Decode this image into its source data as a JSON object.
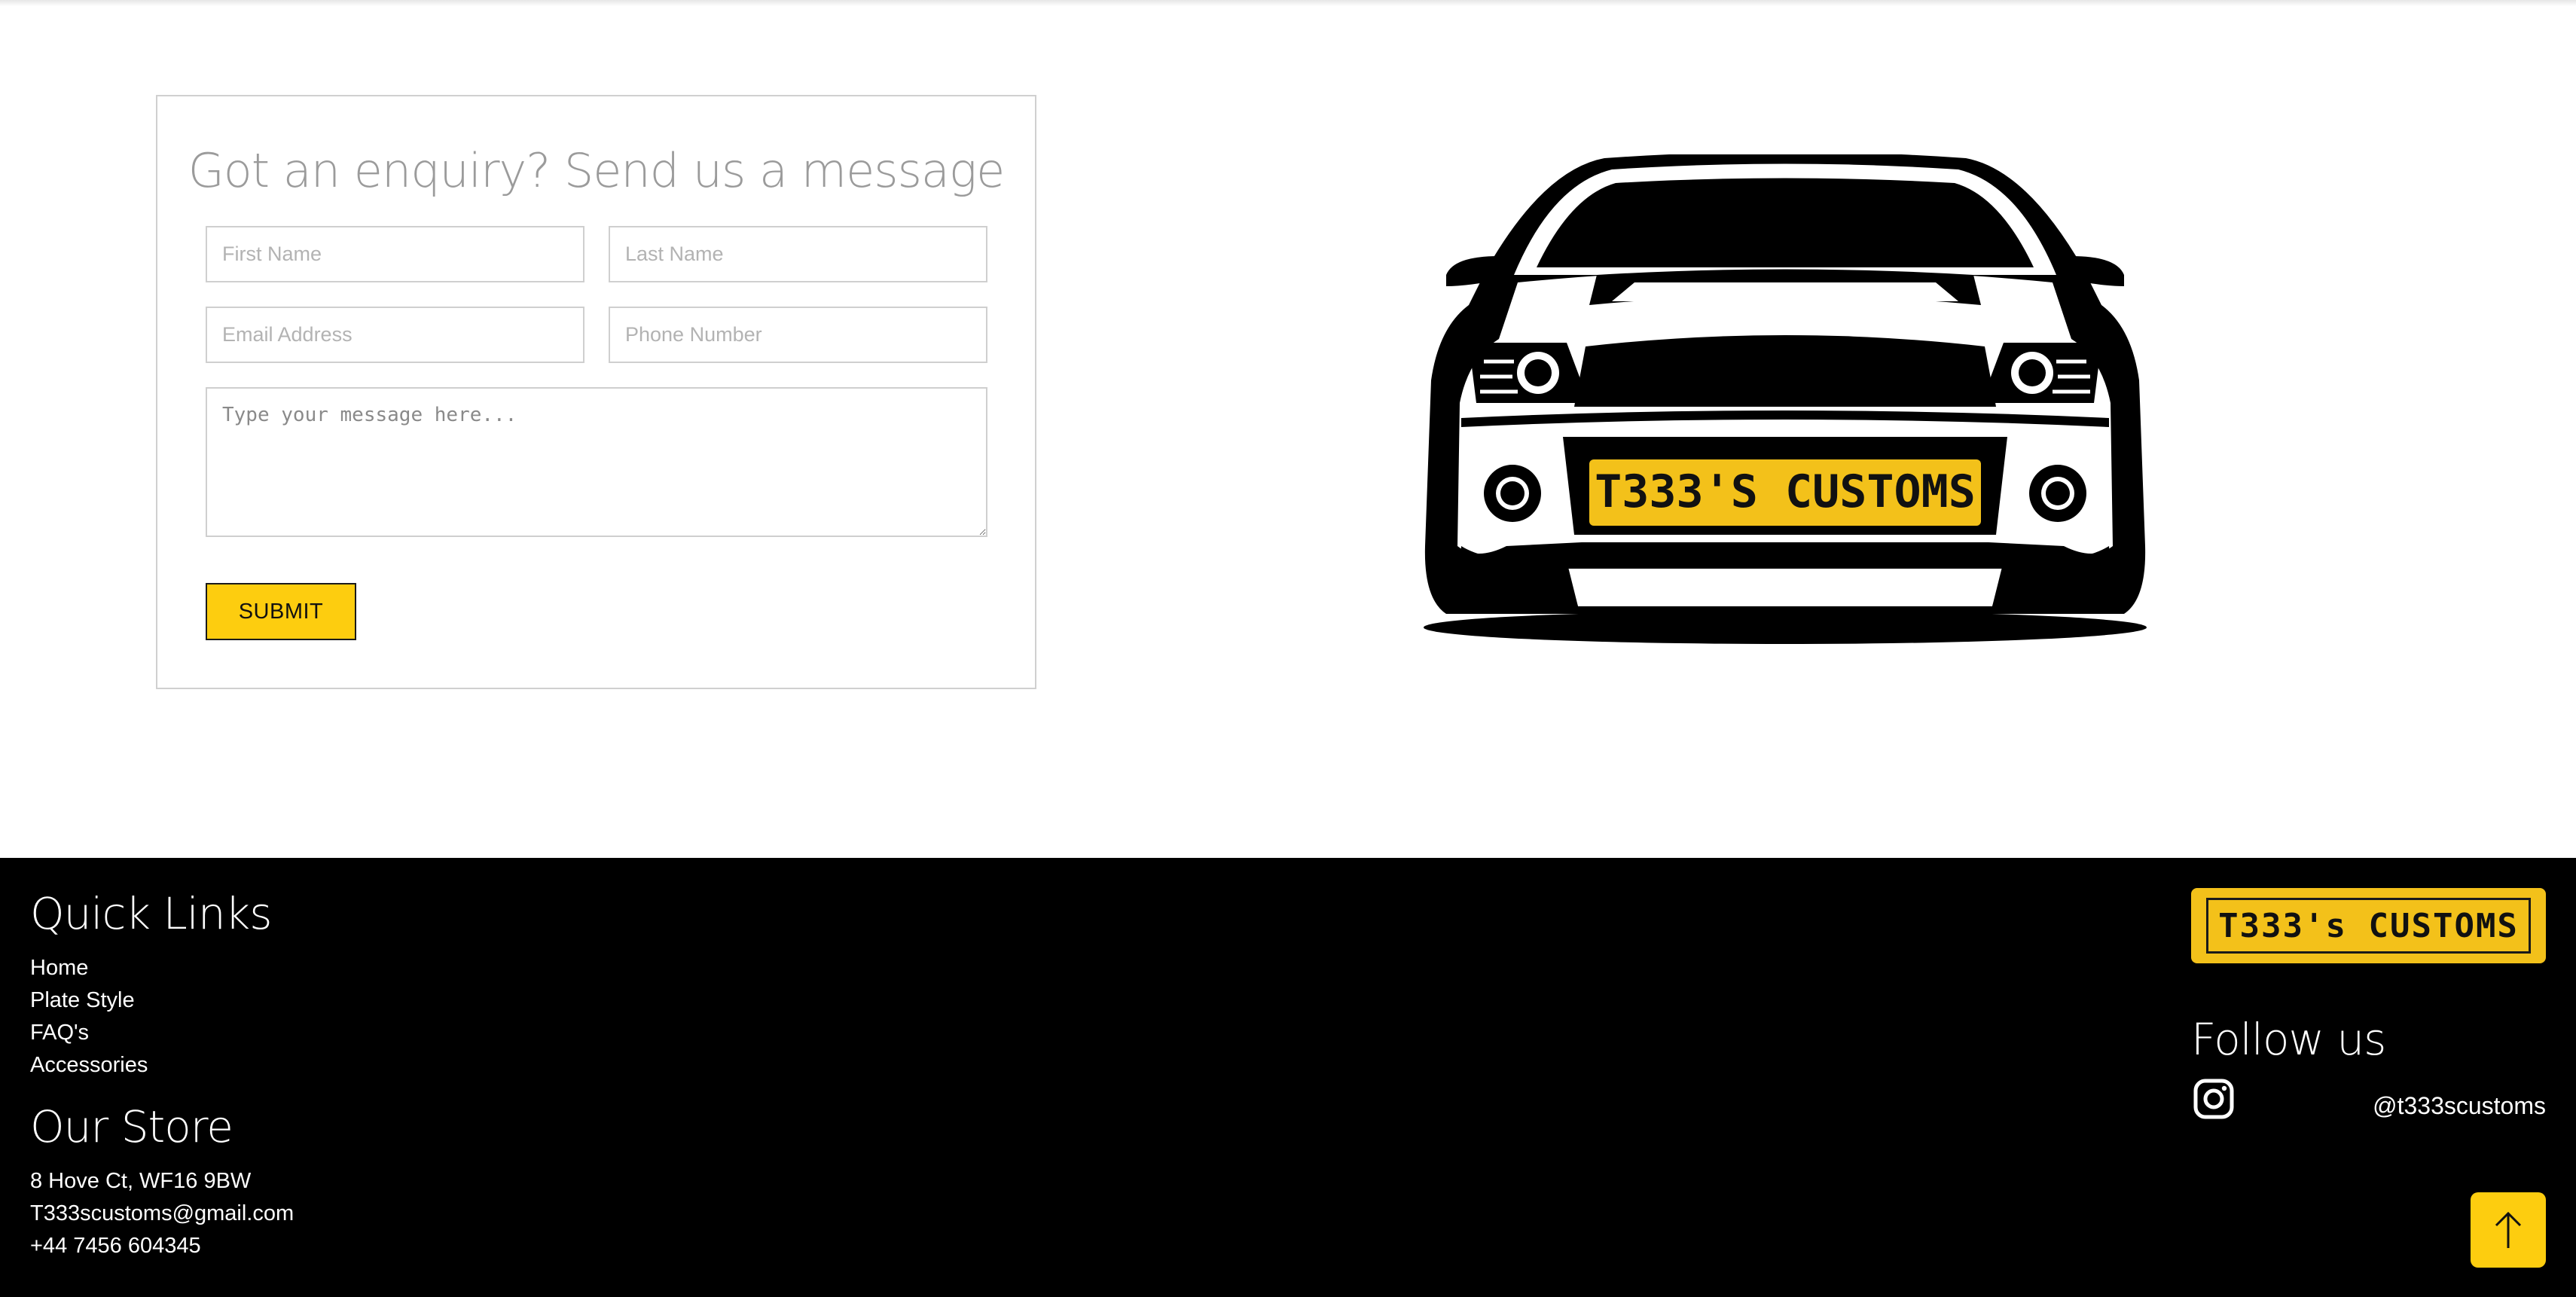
{
  "form": {
    "title": "Got an enquiry? Send us a message",
    "first_name_placeholder": "First Name",
    "last_name_placeholder": "Last Name",
    "email_placeholder": "Email Address",
    "phone_placeholder": "Phone Number",
    "message_placeholder": "Type your message here...",
    "submit_label": "SUBMIT"
  },
  "car_image": {
    "plate_text": "T333'S CUSTOMS",
    "plate_color": "#f3c11a"
  },
  "footer": {
    "quick_links_heading": "Quick Links",
    "quick_links": [
      "Home",
      "Plate Style",
      "FAQ's",
      "Accessories"
    ],
    "store_heading": "Our Store",
    "store_lines": [
      "8 Hove Ct, WF16 9BW",
      "T333scustoms@gmail.com",
      "+44 7456 604345"
    ],
    "logo_text": "T333's CUSTOMS",
    "follow_heading": "Follow us",
    "instagram_icon": "instagram-icon",
    "instagram_handle": "@t333scustoms",
    "back_to_top_icon": "arrow-up-icon"
  },
  "colors": {
    "accent_yellow": "#fdcd0f",
    "footer_bg": "#000000",
    "title_grey": "#9b9b9b"
  }
}
